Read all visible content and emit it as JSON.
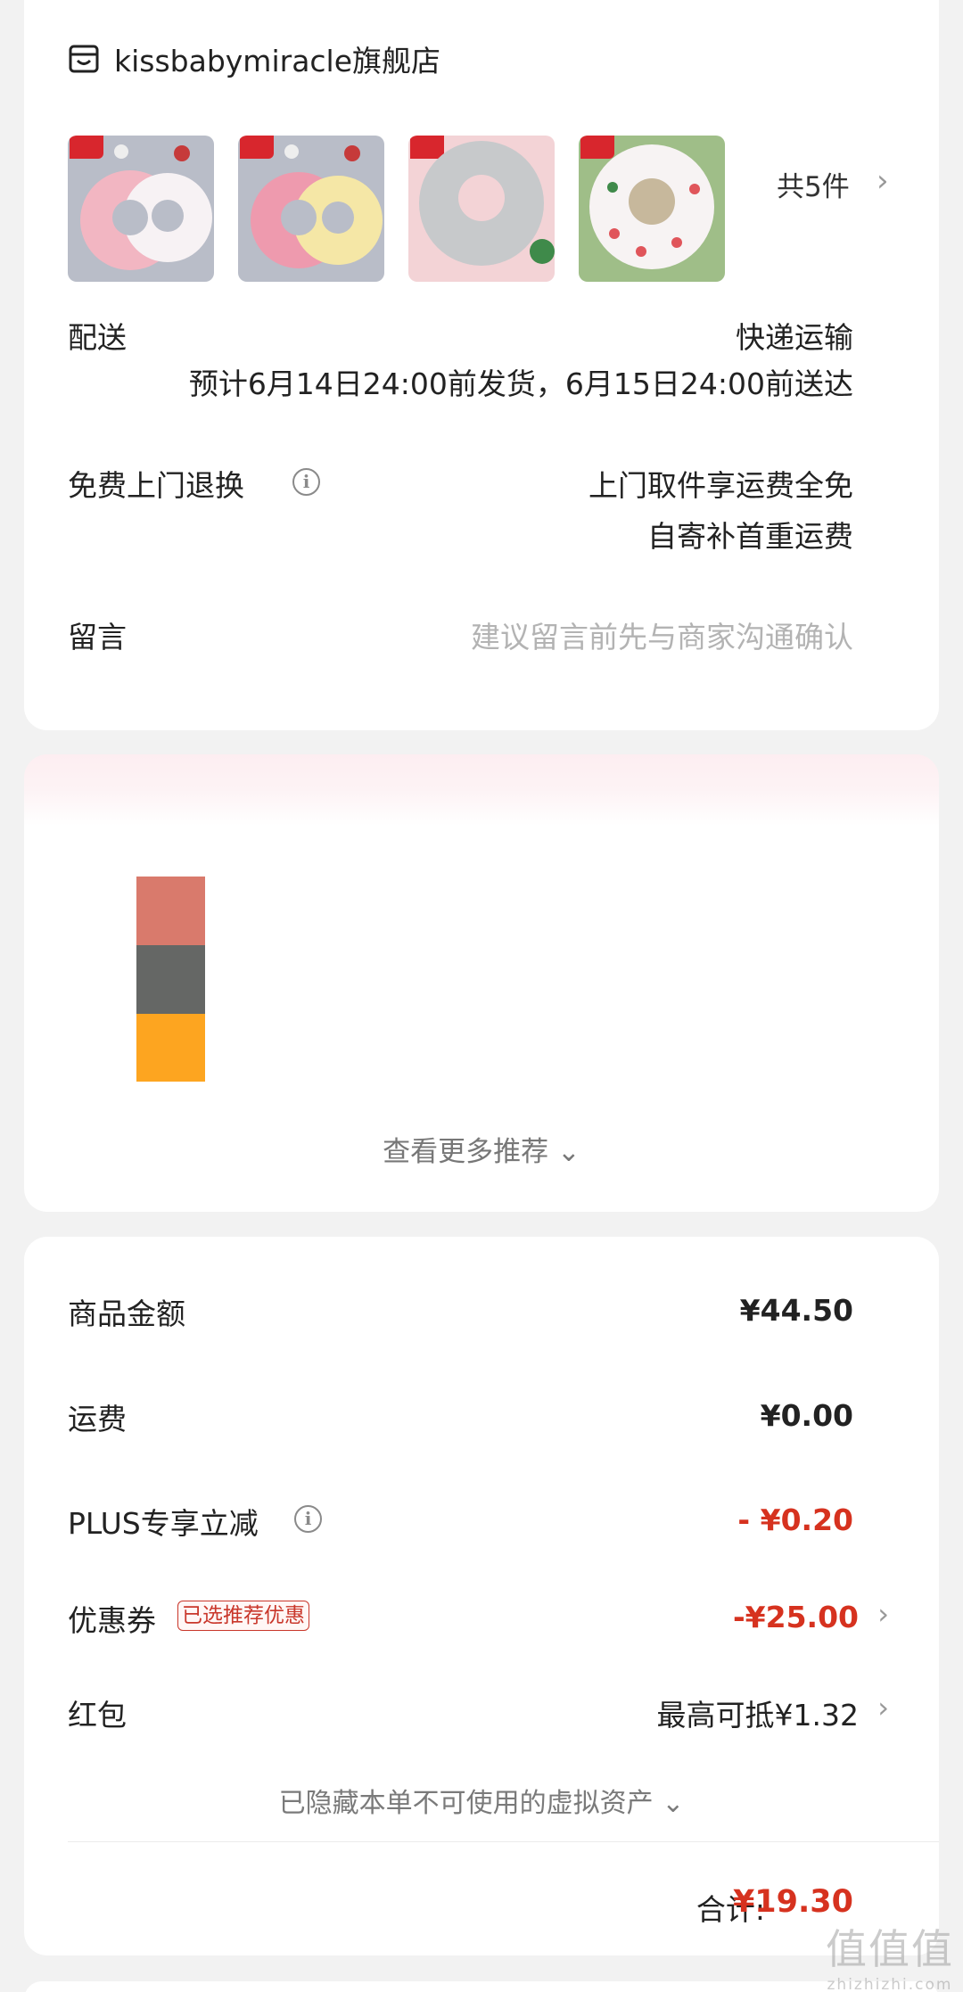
{
  "store": {
    "icon": "store-icon",
    "name": "kissbabymiracle旗舰店",
    "item_count": "共5件",
    "chevron": "›"
  },
  "delivery": {
    "label": "配送",
    "method": "快递运输",
    "estimate": "预计6月14日24:00前发货，6月15日24:00前送达"
  },
  "returns": {
    "label": "免费上门退换",
    "info_icon": "info-icon",
    "line1": "上门取件享运费全免",
    "line2": "自寄补首重运费"
  },
  "message": {
    "label": "留言",
    "placeholder": "建议留言前先与商家沟通确认"
  },
  "recommendations": {
    "more_label": "查看更多推荐 ⌄",
    "swatch_colors": [
      "#d97a6c",
      "#656765",
      "#fda520"
    ]
  },
  "price": {
    "goods_label": "商品金额",
    "goods_value": "¥44.50",
    "shipping_label": "运费",
    "shipping_value": "¥0.00",
    "plus_label": "PLUS专享立减",
    "plus_value": "- ¥0.20",
    "coupon_label": "优惠券",
    "coupon_tag": "已选推荐优惠",
    "coupon_value": "-¥25.00",
    "redpacket_label": "红包",
    "redpacket_value": "最高可抵¥1.32",
    "hidden_note": "已隐藏本单不可使用的虚拟资产 ⌄",
    "total_label": "合计:",
    "total_value": "¥19.30",
    "accent_color": "#d6321f"
  },
  "watermark": {
    "big": "值值值",
    "small": "zhizhizhi.com"
  }
}
